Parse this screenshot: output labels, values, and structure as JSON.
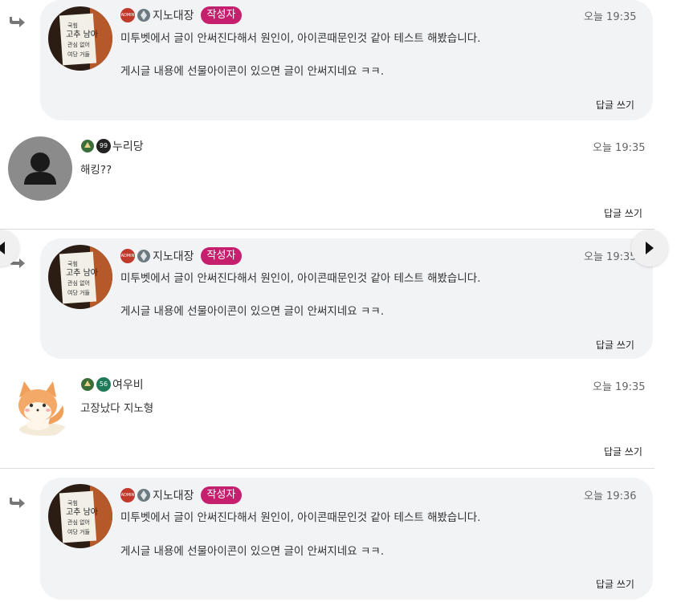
{
  "comments": [
    {
      "type": "reply",
      "author": "지노대장",
      "author_tag": "작성자",
      "time": "오늘 19:35",
      "lines": [
        "미투벳에서 글이 안써진다해서 원인이, 아이콘때문인것 같아 테스트 해봤습니다.",
        "게시글 내용에 선물아이콘이 있으면 글이 안써지네요 ㅋㅋ."
      ],
      "reply_label": "답글 쓰기"
    },
    {
      "type": "comment",
      "author": "누리당",
      "time": "오늘 19:35",
      "lines": [
        "해킹??"
      ],
      "reply_label": "답글 쓰기",
      "level_badge": "99"
    },
    {
      "type": "reply",
      "author": "지노대장",
      "author_tag": "작성자",
      "time": "오늘 19:35",
      "lines": [
        "미투벳에서 글이 안써진다해서 원인이, 아이콘때문인것 같아 테스트 해봤습니다.",
        "게시글 내용에 선물아이콘이 있으면 글이 안써지네요 ㅋㅋ."
      ],
      "reply_label": "답글 쓰기"
    },
    {
      "type": "comment",
      "author": "여우비",
      "time": "오늘 19:35",
      "lines": [
        "고장났다 지노형"
      ],
      "reply_label": "답글 쓰기",
      "level_badge": "56"
    },
    {
      "type": "reply",
      "author": "지노대장",
      "author_tag": "작성자",
      "time": "오늘 19:36",
      "lines": [
        "미투벳에서 글이 안써진다해서 원인이, 아이콘때문인것 같아 테스트 해봤습니다.",
        "게시글 내용에 선물아이콘이 있으면 글이 안써지네요 ㅋㅋ."
      ],
      "reply_label": "답글 쓰기"
    }
  ],
  "admin_badge": "ADMIN",
  "icons": {
    "reply": "reply-arrow-icon",
    "prev": "chevron-left-icon",
    "next": "chevron-right-icon"
  },
  "colors": {
    "author_tag": "#c51f6e",
    "card": "#f2f3f5"
  }
}
